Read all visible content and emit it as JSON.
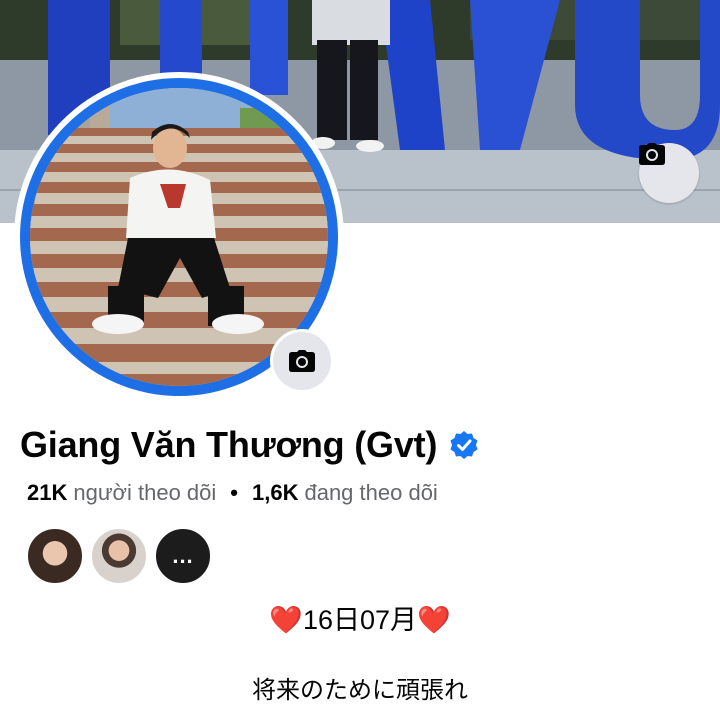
{
  "profile": {
    "name": "Giang Văn Thương (Gvt)",
    "followers_count": "21K",
    "followers_label": "người theo dõi",
    "following_count": "1,6K",
    "following_label": "đang theo dõi",
    "separator": "•",
    "more_followers": "...",
    "bio_line1_heart": "❤️",
    "bio_line1_text": "16日07月",
    "bio_line2": "将来のために頑張れ"
  },
  "icons": {
    "cover_camera": "camera-icon",
    "avatar_camera": "camera-icon",
    "verified": "verified-badge-icon"
  },
  "colors": {
    "accent": "#1e6ee6",
    "verified": "#1877f2",
    "secondary_text": "#65676b",
    "heart": "#e0242e"
  }
}
